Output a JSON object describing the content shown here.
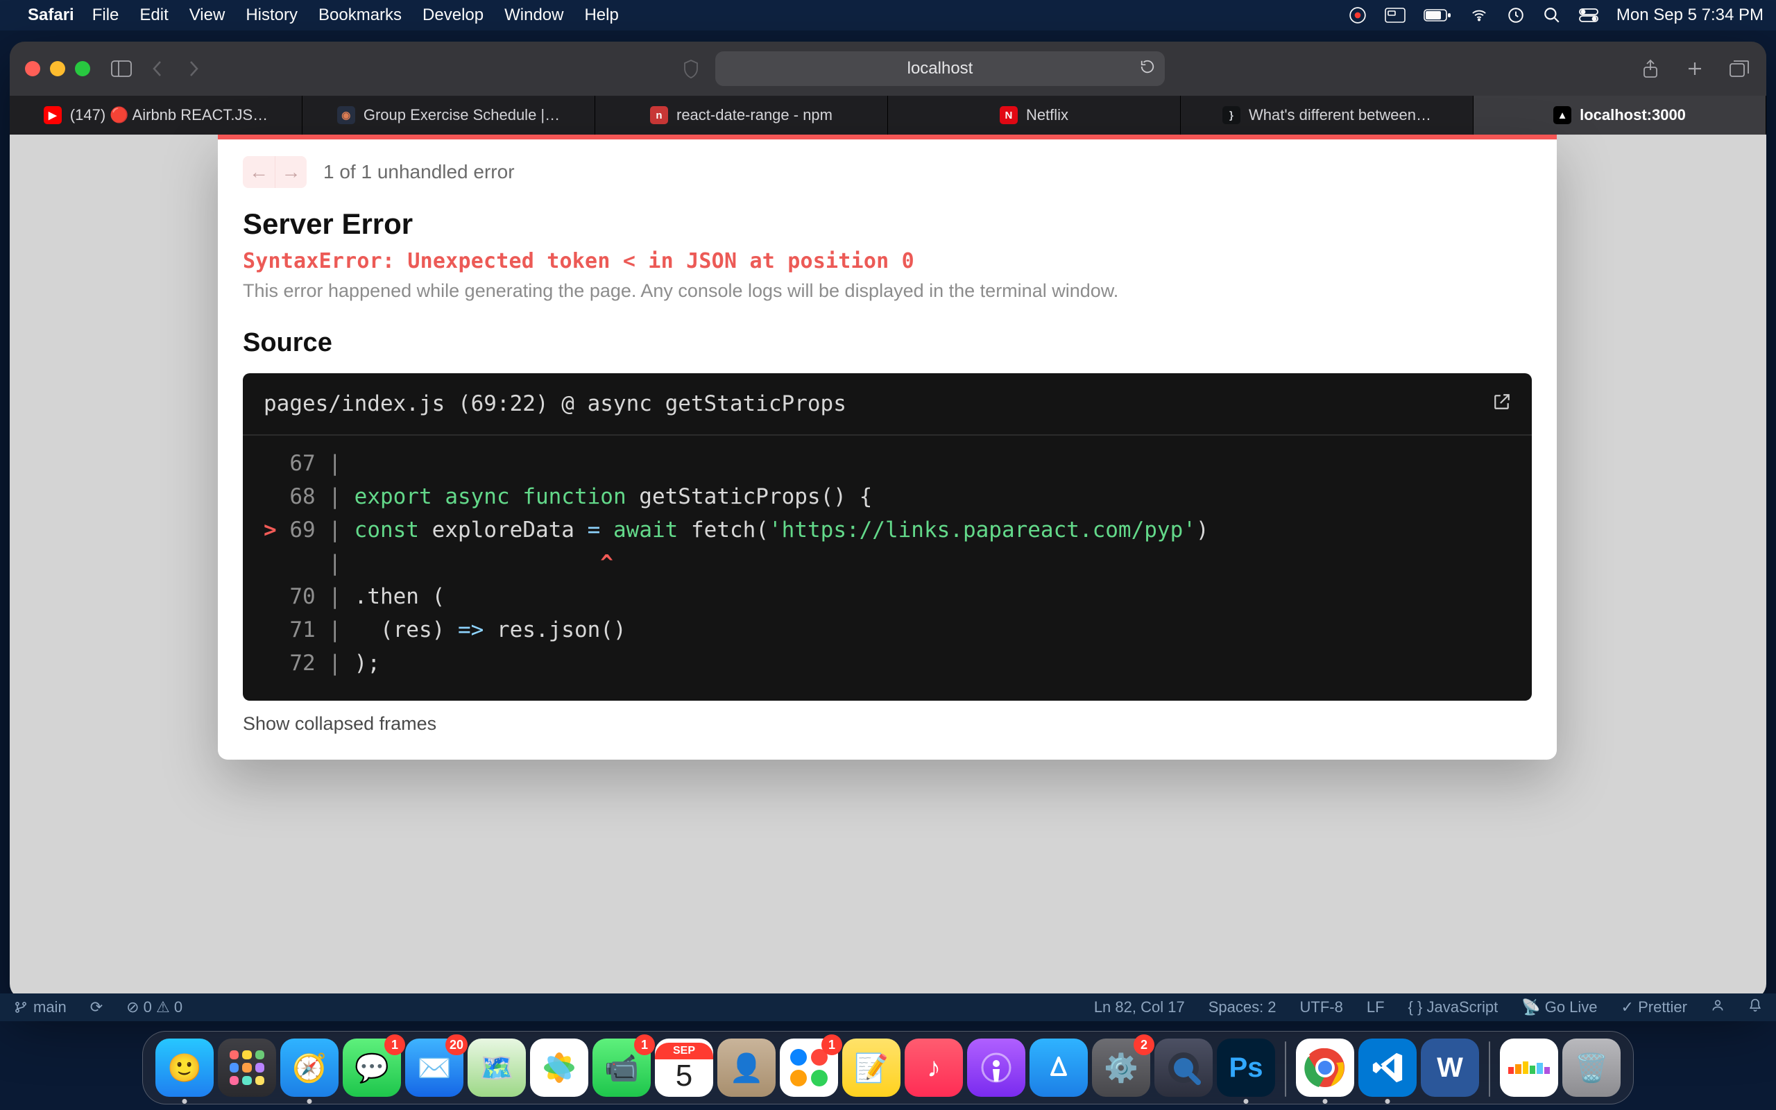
{
  "menubar": {
    "app": "Safari",
    "items": [
      "File",
      "Edit",
      "View",
      "History",
      "Bookmarks",
      "Develop",
      "Window",
      "Help"
    ],
    "clock": "Mon Sep 5  7:34 PM"
  },
  "safari": {
    "address": "localhost",
    "tabs": [
      {
        "label": "(147) 🔴 Airbnb REACT.JS…",
        "iconBg": "#ff0000",
        "iconFg": "#fff",
        "iconTxt": "▶"
      },
      {
        "label": "Group Exercise Schedule |…",
        "iconBg": "#273042",
        "iconFg": "#e07f56",
        "iconTxt": "◉"
      },
      {
        "label": "react-date-range - npm",
        "iconBg": "#cb3837",
        "iconFg": "#fff",
        "iconTxt": "n"
      },
      {
        "label": "Netflix",
        "iconBg": "#e50914",
        "iconFg": "#fff",
        "iconTxt": "N"
      },
      {
        "label": "What's different between…",
        "iconBg": "#121416",
        "iconFg": "#cfd2d6",
        "iconTxt": "}"
      },
      {
        "label": "localhost:3000",
        "iconBg": "#000",
        "iconFg": "#fff",
        "iconTxt": "▲"
      }
    ],
    "activeTab": 5
  },
  "error": {
    "counter": "1 of 1 unhandled error",
    "title": "Server Error",
    "message": "SyntaxError: Unexpected token < in JSON at position 0",
    "description": "This error happened while generating the page. Any console logs will be displayed in the terminal window.",
    "sourceTitle": "Source",
    "sourceHeader": "pages/index.js (69:22) @ async getStaticProps",
    "code": {
      "lines": [
        {
          "n": "67",
          "txt": ""
        },
        {
          "n": "68",
          "kw1": "export",
          "kw2": "async",
          "kw3": "function",
          "fn": "getStaticProps",
          "rest": "() {"
        },
        {
          "n": "69",
          "mark": ">",
          "kw1": "const",
          "var": "exploreData",
          "op": "=",
          "kw2": "await",
          "fn": "fetch",
          "paren": "(",
          "str": "'https://links.papareact.com/pyp'",
          "close": ")"
        },
        {
          "caret": "^"
        },
        {
          "n": "70",
          "txt": ".then ("
        },
        {
          "n": "71",
          "p1": "(res)",
          "op": "=>",
          "p2": "res.json()"
        },
        {
          "n": "72",
          "txt": ");"
        }
      ]
    },
    "showFrames": "Show collapsed frames"
  },
  "vscodeStatus": {
    "branch": "main",
    "sync": "⟳",
    "errwarn": "⊘ 0 ⚠ 0",
    "pos": "Ln 82, Col 17",
    "spaces": "Spaces: 2",
    "enc": "UTF-8",
    "eol": "LF",
    "lang": "JavaScript",
    "golive": "Go Live",
    "prettier": "Prettier"
  },
  "dock": {
    "calMonth": "SEP",
    "calDay": "5",
    "badges": {
      "messages": "1",
      "mail": "20",
      "facetime": "1",
      "reminders": "1",
      "settings": "2"
    },
    "psLabel": "Ps",
    "wordLabel": "W"
  }
}
